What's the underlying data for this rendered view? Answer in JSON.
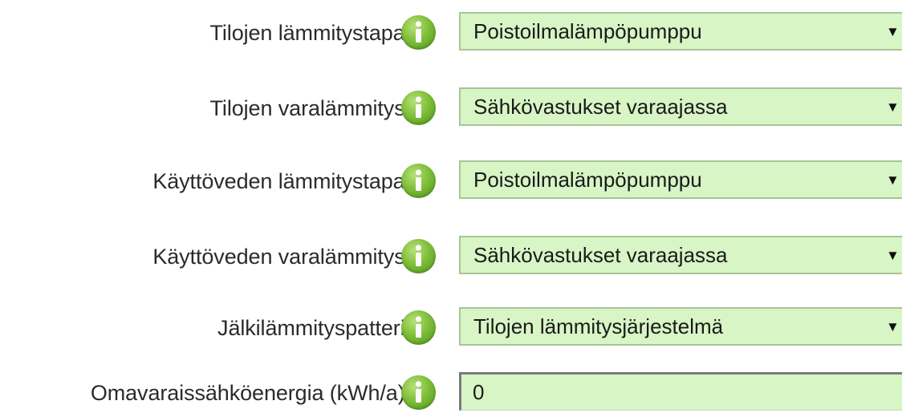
{
  "form": {
    "rows": [
      {
        "label": "Tilojen lämmitystapa:",
        "value": "Poistoilmalämpöpumppu"
      },
      {
        "label": "Tilojen varalämmitys:",
        "value": "Sähkövastukset varaajassa"
      },
      {
        "label": "Käyttöveden lämmitystapa:",
        "value": "Poistoilmalämpöpumppu"
      },
      {
        "label": "Käyttöveden varalämmitys:",
        "value": "Sähkövastukset varaajassa"
      },
      {
        "label": "Jälkilämmityspatteri:",
        "value": "Tilojen lämmitysjärjestelmä"
      },
      {
        "label": "Omavaraissähköenergia (kWh/a):",
        "value": "0"
      }
    ],
    "dropdown_arrow": "▼",
    "info_icon": "info-icon"
  },
  "colors": {
    "field_background": "#d8f5c5",
    "field_border": "#a8c596",
    "info_icon_green": "#7fbf3a",
    "label_text": "#2b2b2b"
  }
}
